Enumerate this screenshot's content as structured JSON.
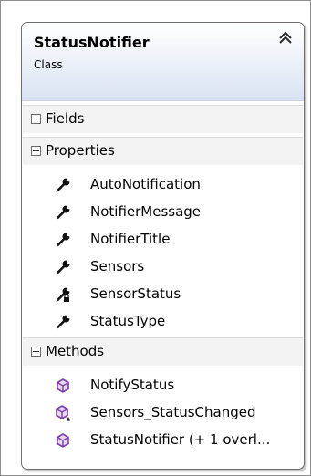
{
  "class_box": {
    "name": "StatusNotifier",
    "kind": "Class"
  },
  "sections": {
    "fields": {
      "label": "Fields",
      "expanded": false
    },
    "properties": {
      "label": "Properties",
      "expanded": true,
      "items": [
        {
          "label": "AutoNotification",
          "icon": "wrench-icon"
        },
        {
          "label": "NotifierMessage",
          "icon": "wrench-icon"
        },
        {
          "label": "NotifierTitle",
          "icon": "wrench-icon"
        },
        {
          "label": "Sensors",
          "icon": "wrench-icon"
        },
        {
          "label": "SensorStatus",
          "icon": "wrench-lock-icon"
        },
        {
          "label": "StatusType",
          "icon": "wrench-icon"
        }
      ]
    },
    "methods": {
      "label": "Methods",
      "expanded": true,
      "items": [
        {
          "label": "NotifyStatus",
          "icon": "method-cube-icon"
        },
        {
          "label": "Sensors_StatusChanged",
          "icon": "method-cube-star-icon"
        },
        {
          "label": "StatusNotifier (+ 1 overl...",
          "icon": "method-cube-icon"
        }
      ]
    }
  },
  "colors": {
    "header_gradient_end": "#d9e3f2",
    "method_icon": "#7b3fa8",
    "section_bg": "#f3f3f3"
  }
}
